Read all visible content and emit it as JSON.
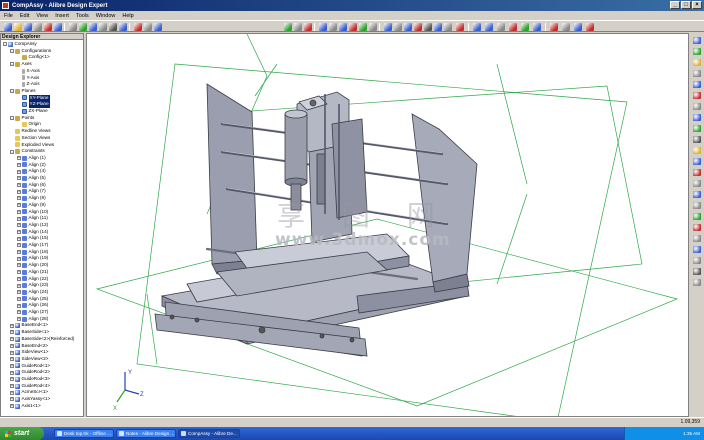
{
  "window": {
    "title": "CompAssy - Alibre Design Expert"
  },
  "menu": [
    "File",
    "Edit",
    "View",
    "Insert",
    "Tools",
    "Window",
    "Help"
  ],
  "explorer": {
    "title": "Design Explorer",
    "items": [
      {
        "label": "CompAssy",
        "level": 0,
        "icon": "assembly-icon",
        "expander": "-"
      },
      {
        "label": "Configurations",
        "level": 1,
        "icon": "folder-icon",
        "expander": "-"
      },
      {
        "label": "Config<1>",
        "level": 2,
        "icon": "folder-icon",
        "expander": ""
      },
      {
        "label": "Axes",
        "level": 1,
        "icon": "folder-icon",
        "expander": "-"
      },
      {
        "label": "X-Axis",
        "level": 2,
        "icon": "axis-icon",
        "expander": ""
      },
      {
        "label": "Y-Axis",
        "level": 2,
        "icon": "axis-icon",
        "expander": ""
      },
      {
        "label": "Z-Axis",
        "level": 2,
        "icon": "axis-icon",
        "expander": ""
      },
      {
        "label": "Planes",
        "level": 1,
        "icon": "folder-icon",
        "expander": "-"
      },
      {
        "label": "XY-Plane",
        "level": 2,
        "icon": "plane-icon",
        "expander": "",
        "selected": true
      },
      {
        "label": "YZ-Plane",
        "level": 2,
        "icon": "plane-icon",
        "expander": "",
        "selected": true
      },
      {
        "label": "ZX-Plane",
        "level": 2,
        "icon": "plane-icon",
        "expander": ""
      },
      {
        "label": "Points",
        "level": 1,
        "icon": "folder-icon",
        "expander": "-"
      },
      {
        "label": "Origin",
        "level": 2,
        "icon": "point-icon",
        "expander": ""
      },
      {
        "label": "Redline Views",
        "level": 1,
        "icon": "view-icon",
        "expander": ""
      },
      {
        "label": "Section Views",
        "level": 1,
        "icon": "view-icon",
        "expander": ""
      },
      {
        "label": "Exploded Views",
        "level": 1,
        "icon": "view-icon",
        "expander": ""
      },
      {
        "label": "Constraints",
        "level": 1,
        "icon": "folder-icon",
        "expander": "-"
      },
      {
        "label": "Align (1)",
        "level": 2,
        "icon": "constraint-icon",
        "expander": "+"
      },
      {
        "label": "Align (2)",
        "level": 2,
        "icon": "constraint-icon",
        "expander": "+"
      },
      {
        "label": "Align (4)",
        "level": 2,
        "icon": "constraint-icon",
        "expander": "+"
      },
      {
        "label": "Align (5)",
        "level": 2,
        "icon": "constraint-icon",
        "expander": "+"
      },
      {
        "label": "Align (6)",
        "level": 2,
        "icon": "constraint-icon",
        "expander": "+"
      },
      {
        "label": "Align (7)",
        "level": 2,
        "icon": "constraint-icon",
        "expander": "+"
      },
      {
        "label": "Align (8)",
        "level": 2,
        "icon": "constraint-icon",
        "expander": "+"
      },
      {
        "label": "Align (9)",
        "level": 2,
        "icon": "constraint-icon",
        "expander": "+"
      },
      {
        "label": "Align (10)",
        "level": 2,
        "icon": "constraint-icon",
        "expander": "+"
      },
      {
        "label": "Align (11)",
        "level": 2,
        "icon": "constraint-icon",
        "expander": "+"
      },
      {
        "label": "Align (12)",
        "level": 2,
        "icon": "constraint-icon",
        "expander": "+"
      },
      {
        "label": "Align (14)",
        "level": 2,
        "icon": "constraint-icon",
        "expander": "+"
      },
      {
        "label": "Align (15)",
        "level": 2,
        "icon": "constraint-icon",
        "expander": "+"
      },
      {
        "label": "Align (17)",
        "level": 2,
        "icon": "constraint-icon",
        "expander": "+"
      },
      {
        "label": "Align (18)",
        "level": 2,
        "icon": "constraint-icon",
        "expander": "+"
      },
      {
        "label": "Align (19)",
        "level": 2,
        "icon": "constraint-icon",
        "expander": "+"
      },
      {
        "label": "Align (20)",
        "level": 2,
        "icon": "constraint-icon",
        "expander": "+"
      },
      {
        "label": "Align (21)",
        "level": 2,
        "icon": "constraint-icon",
        "expander": "+"
      },
      {
        "label": "Align (22)",
        "level": 2,
        "icon": "constraint-icon",
        "expander": "+"
      },
      {
        "label": "Align (23)",
        "level": 2,
        "icon": "constraint-icon",
        "expander": "+"
      },
      {
        "label": "Align (24)",
        "level": 2,
        "icon": "constraint-icon",
        "expander": "+"
      },
      {
        "label": "Align (25)",
        "level": 2,
        "icon": "constraint-icon",
        "expander": "+"
      },
      {
        "label": "Align (26)",
        "level": 2,
        "icon": "constraint-icon",
        "expander": "+"
      },
      {
        "label": "Align (27)",
        "level": 2,
        "icon": "constraint-icon",
        "expander": "+"
      },
      {
        "label": "Align (28)",
        "level": 2,
        "icon": "constraint-icon",
        "expander": "+"
      },
      {
        "label": "BaseEnd<1>",
        "level": 1,
        "icon": "part-icon",
        "expander": "+"
      },
      {
        "label": "BaseSide<1>",
        "level": 1,
        "icon": "part-icon",
        "expander": "+"
      },
      {
        "label": "BaseSide<2>(Reinforced)",
        "level": 1,
        "icon": "part-icon",
        "expander": "+"
      },
      {
        "label": "BaseEnd<2>",
        "level": 1,
        "icon": "part-icon",
        "expander": "+"
      },
      {
        "label": "SideView<1>",
        "level": 1,
        "icon": "part-icon",
        "expander": "+"
      },
      {
        "label": "SideView<2>",
        "level": 1,
        "icon": "part-icon",
        "expander": "+"
      },
      {
        "label": "GuideRod<1>",
        "level": 1,
        "icon": "part-icon",
        "expander": "+"
      },
      {
        "label": "GuideRod<2>",
        "level": 1,
        "icon": "part-icon",
        "expander": "+"
      },
      {
        "label": "GuideRod<3>",
        "level": 1,
        "icon": "part-icon",
        "expander": "+"
      },
      {
        "label": "GuideRod<4>",
        "level": 1,
        "icon": "part-icon",
        "expander": "+"
      },
      {
        "label": "AcmeScr<1>",
        "level": 1,
        "icon": "part-icon",
        "expander": "+"
      },
      {
        "label": "AxisYassy<1>",
        "level": 1,
        "icon": "part-icon",
        "expander": "+"
      },
      {
        "label": "Axis1<1>",
        "level": 1,
        "icon": "part-icon",
        "expander": "+"
      }
    ]
  },
  "viewport": {
    "watermark": "www.3dmox.com",
    "watermark_cn": "享 图 网",
    "triad": {
      "x": "X",
      "y": "Y",
      "z": "Z"
    }
  },
  "status": {
    "coords": "1.09,359"
  },
  "taskbar": {
    "start": "start",
    "tasks": [
      {
        "label": "Desk top.trk - Offline ..."
      },
      {
        "label": "Notes - Alibre Design ..."
      },
      {
        "label": "CompAssy - Alibre De...",
        "active": true
      }
    ],
    "clock": "1:35 AM"
  },
  "colors": {
    "titlebar": "#0a246a",
    "plane_lines": "#2fa84a",
    "model_gray": "#a9acb8",
    "selection": "#0a246a"
  }
}
